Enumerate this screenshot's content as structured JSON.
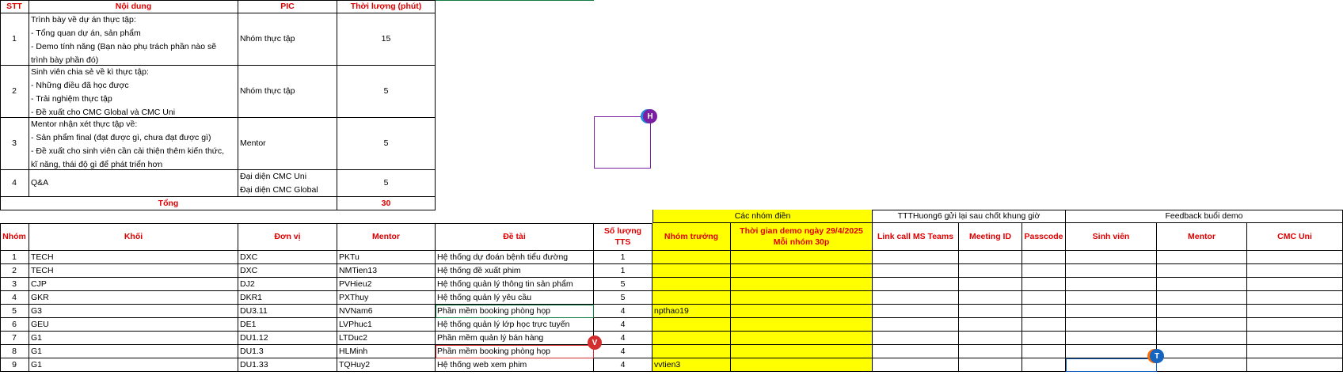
{
  "agenda": {
    "headers": [
      "STT",
      "Nội dung",
      "PIC",
      "Thời lượng (phút)"
    ],
    "rows": [
      {
        "stt": "1",
        "lines": [
          "Trình bày về dự án thực tập:",
          "- Tổng quan dự án, sản phẩm",
          "- Demo tính năng (Bạn nào phụ trách phần nào sẽ",
          "trình bày phần đó)"
        ],
        "pic": [
          "Nhóm thực tập"
        ],
        "dur": "15"
      },
      {
        "stt": "2",
        "lines": [
          "Sinh viên chia sẻ về kì thực tập:",
          "- Những điều đã học được",
          "- Trải nghiệm thực tập",
          "- Đề xuất cho CMC Global và CMC Uni"
        ],
        "pic": [
          "Nhóm thực tập"
        ],
        "dur": "5"
      },
      {
        "stt": "3",
        "lines": [
          "Mentor nhận xét thực tập về:",
          "- Sản phẩm final (đạt được gì, chưa đạt được gì)",
          "- Đề xuất cho sinh viên cần cải thiện thêm kiến thức,",
          "kĩ năng, thái độ gì để phát triển hơn"
        ],
        "pic": [
          "Mentor"
        ],
        "dur": "5"
      },
      {
        "stt": "4",
        "lines": [
          "Q&A"
        ],
        "pic": [
          "Đại diện CMC Uni",
          "Đại diện CMC Global"
        ],
        "dur": "5"
      }
    ],
    "total_label": "Tổng",
    "total_value": "30"
  },
  "groups": {
    "section_headers": {
      "fill": "Các nhóm điền",
      "teams": "TTTHuong6 gửi lại sau chốt khung giờ",
      "feedback": "Feedback buổi demo"
    },
    "headers": [
      "Nhóm",
      "Khối",
      "Đơn vị",
      "Mentor",
      "Đề tài",
      "Số lượng TTS",
      "Nhóm trưởng",
      "Thời gian demo ngày 29/4/2025\nMỗi nhóm 30p",
      "Link call MS Teams",
      "Meeting ID",
      "Passcode",
      "Sinh viên",
      "Mentor",
      "CMC Uni"
    ],
    "rows": [
      [
        "1",
        "TECH",
        "DXC",
        "PKTu",
        "Hệ thống dự đoán bệnh tiểu đường",
        "1",
        "",
        "",
        "",
        "",
        "",
        "",
        "",
        ""
      ],
      [
        "2",
        "TECH",
        "DXC",
        "NMTien13",
        "Hệ thống đề xuất phim",
        "1",
        "",
        "",
        "",
        "",
        "",
        "",
        "",
        ""
      ],
      [
        "3",
        "CJP",
        "DJ2",
        "PVHieu2",
        "Hệ thống quản lý thông tin sản phẩm",
        "5",
        "",
        "",
        "",
        "",
        "",
        "",
        "",
        ""
      ],
      [
        "4",
        "GKR",
        "DKR1",
        "PXThuy",
        "Hệ thống quản lý yêu cầu",
        "5",
        "",
        "",
        "",
        "",
        "",
        "",
        "",
        ""
      ],
      [
        "5",
        "G3",
        "DU3.11",
        "NVNam6",
        "Phần mềm booking phòng họp",
        "4",
        "npthao19",
        "",
        "",
        "",
        "",
        "",
        "",
        ""
      ],
      [
        "6",
        "GEU",
        "DE1",
        "LVPhuc1",
        "Hệ thống quản lý lớp học trực tuyến",
        "4",
        "",
        "",
        "",
        "",
        "",
        "",
        "",
        ""
      ],
      [
        "7",
        "G1",
        "DU1.12",
        "LTDuc2",
        "Phần mềm quản lý bán hàng",
        "4",
        "",
        "",
        "",
        "",
        "",
        "",
        "",
        ""
      ],
      [
        "8",
        "G1",
        "DU1.3",
        "HLMinh",
        "Phần mềm booking phòng họp",
        "4",
        "",
        "",
        "",
        "",
        "",
        "",
        "",
        ""
      ],
      [
        "9",
        "G1",
        "DU1.33",
        "TQHuy2",
        "Hệ thống web xem phim",
        "4",
        "vvtien3",
        "",
        "",
        "",
        "",
        "",
        "",
        ""
      ]
    ]
  },
  "presence": [
    {
      "initial": "H",
      "color": "#7b1fa2"
    },
    {
      "initial": "V",
      "color": "#d32f2f"
    },
    {
      "initial": "T",
      "color": "#1565c0"
    }
  ],
  "colors": {
    "header_red": "#e00000",
    "fill_yellow": "#ffff00",
    "green_selection": "#107c41"
  }
}
